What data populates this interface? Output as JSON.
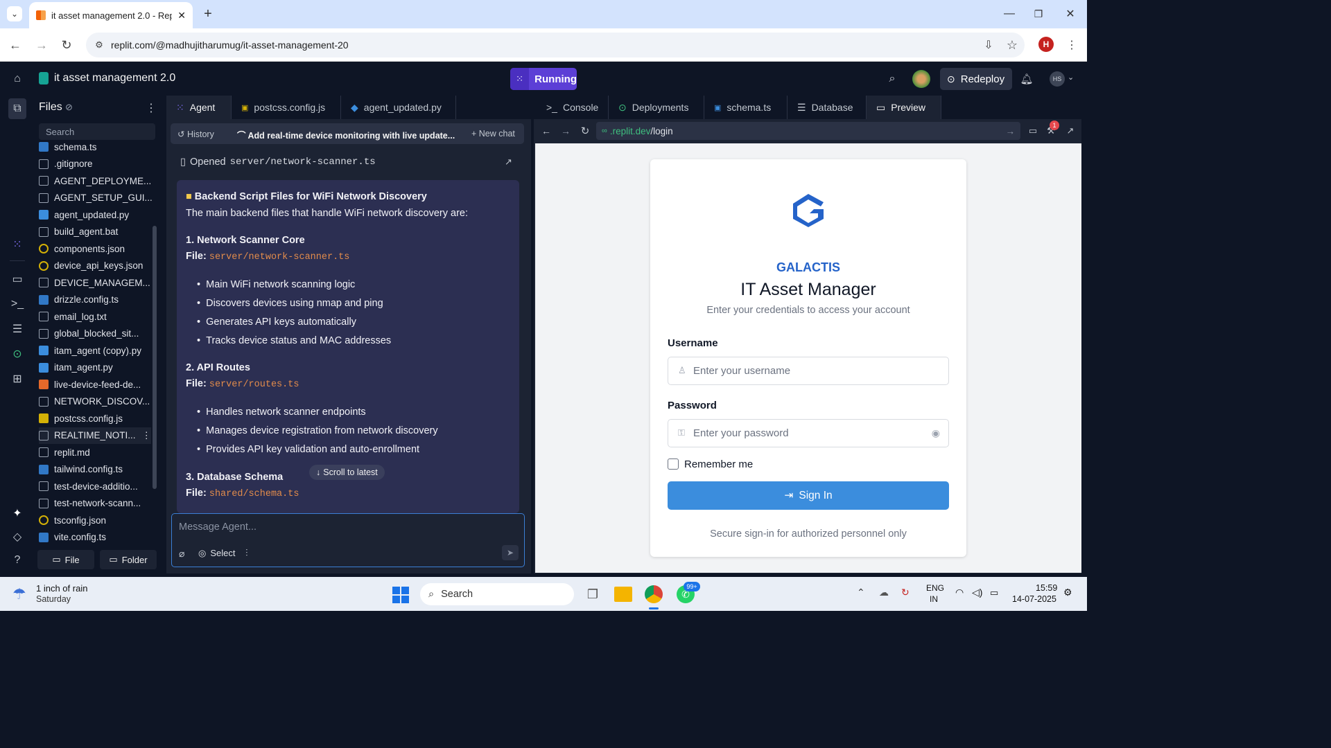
{
  "browser": {
    "tab_title": "it asset management 2.0 - Repli",
    "url": "replit.com/@madhujitharumug/it-asset-management-20",
    "profile_initial": "H"
  },
  "topbar": {
    "project": "it asset management 2.0",
    "status": "Running",
    "redeploy": "Redeploy",
    "user_initials": "HS"
  },
  "files": {
    "title": "Files",
    "search_placeholder": "Search",
    "items": [
      "schema.ts",
      ".gitignore",
      "AGENT_DEPLOYME...",
      "AGENT_SETUP_GUI...",
      "agent_updated.py",
      "build_agent.bat",
      "components.json",
      "device_api_keys.json",
      "DEVICE_MANAGEM...",
      "drizzle.config.ts",
      "email_log.txt",
      "global_blocked_sit...",
      "itam_agent (copy).py",
      "itam_agent.py",
      "live-device-feed-de...",
      "NETWORK_DISCOV...",
      "postcss.config.js",
      "REALTIME_NOTI...",
      "replit.md",
      "tailwind.config.ts",
      "test-device-additio...",
      "test-network-scann...",
      "tsconfig.json",
      "vite.config.ts"
    ],
    "new_file": "File",
    "new_folder": "Folder"
  },
  "agent": {
    "tabs": [
      "Agent",
      "postcss.config.js",
      "agent_updated.py"
    ],
    "history": "History",
    "chat_title": "Add real-time device monitoring with live update...",
    "new_chat": "New chat",
    "opened_prefix": "Opened",
    "opened_file": "server/network-scanner.ts",
    "heading": "Backend Script Files for WiFi Network Discovery",
    "intro": "The main backend files that handle WiFi network discovery are:",
    "sec1": {
      "title": "1. Network Scanner Core",
      "file_label": "File:",
      "file": "server/network-scanner.ts",
      "bullets": [
        "Main WiFi network scanning logic",
        "Discovers devices using nmap and ping",
        "Generates API keys automatically",
        "Tracks device status and MAC addresses"
      ]
    },
    "sec2": {
      "title": "2. API Routes",
      "file_label": "File:",
      "file": "server/routes.ts",
      "bullets": [
        "Handles network scanner endpoints",
        "Manages device registration from network discovery",
        "Provides API key validation and auto-enrollment"
      ]
    },
    "sec3": {
      "title": "3. Database Schema",
      "file_label": "File:",
      "file": "shared/schema.ts"
    },
    "scroll_latest": "Scroll to latest",
    "input_placeholder": "Message Agent...",
    "select": "Select"
  },
  "right": {
    "tabs": [
      "Console",
      "Deployments",
      "schema.ts",
      "Database",
      "Preview"
    ],
    "url_prefix": ".replit.dev",
    "url_path": "/login",
    "badge": "1"
  },
  "login": {
    "brand": "GALACTIS",
    "title": "IT Asset Manager",
    "subtitle": "Enter your credentials to access your account",
    "username_label": "Username",
    "username_placeholder": "Enter your username",
    "password_label": "Password",
    "password_placeholder": "Enter your password",
    "remember": "Remember me",
    "signin": "Sign In",
    "footer": "Secure sign-in for authorized personnel only",
    "accent": "#3b8ddd",
    "brand_color": "#2563c9"
  },
  "taskbar": {
    "weather_line1": "1 inch of rain",
    "weather_line2": "Saturday",
    "search": "Search",
    "lang1": "ENG",
    "lang2": "IN",
    "time": "15:59",
    "date": "14-07-2025",
    "whatsapp_badge": "99+"
  }
}
